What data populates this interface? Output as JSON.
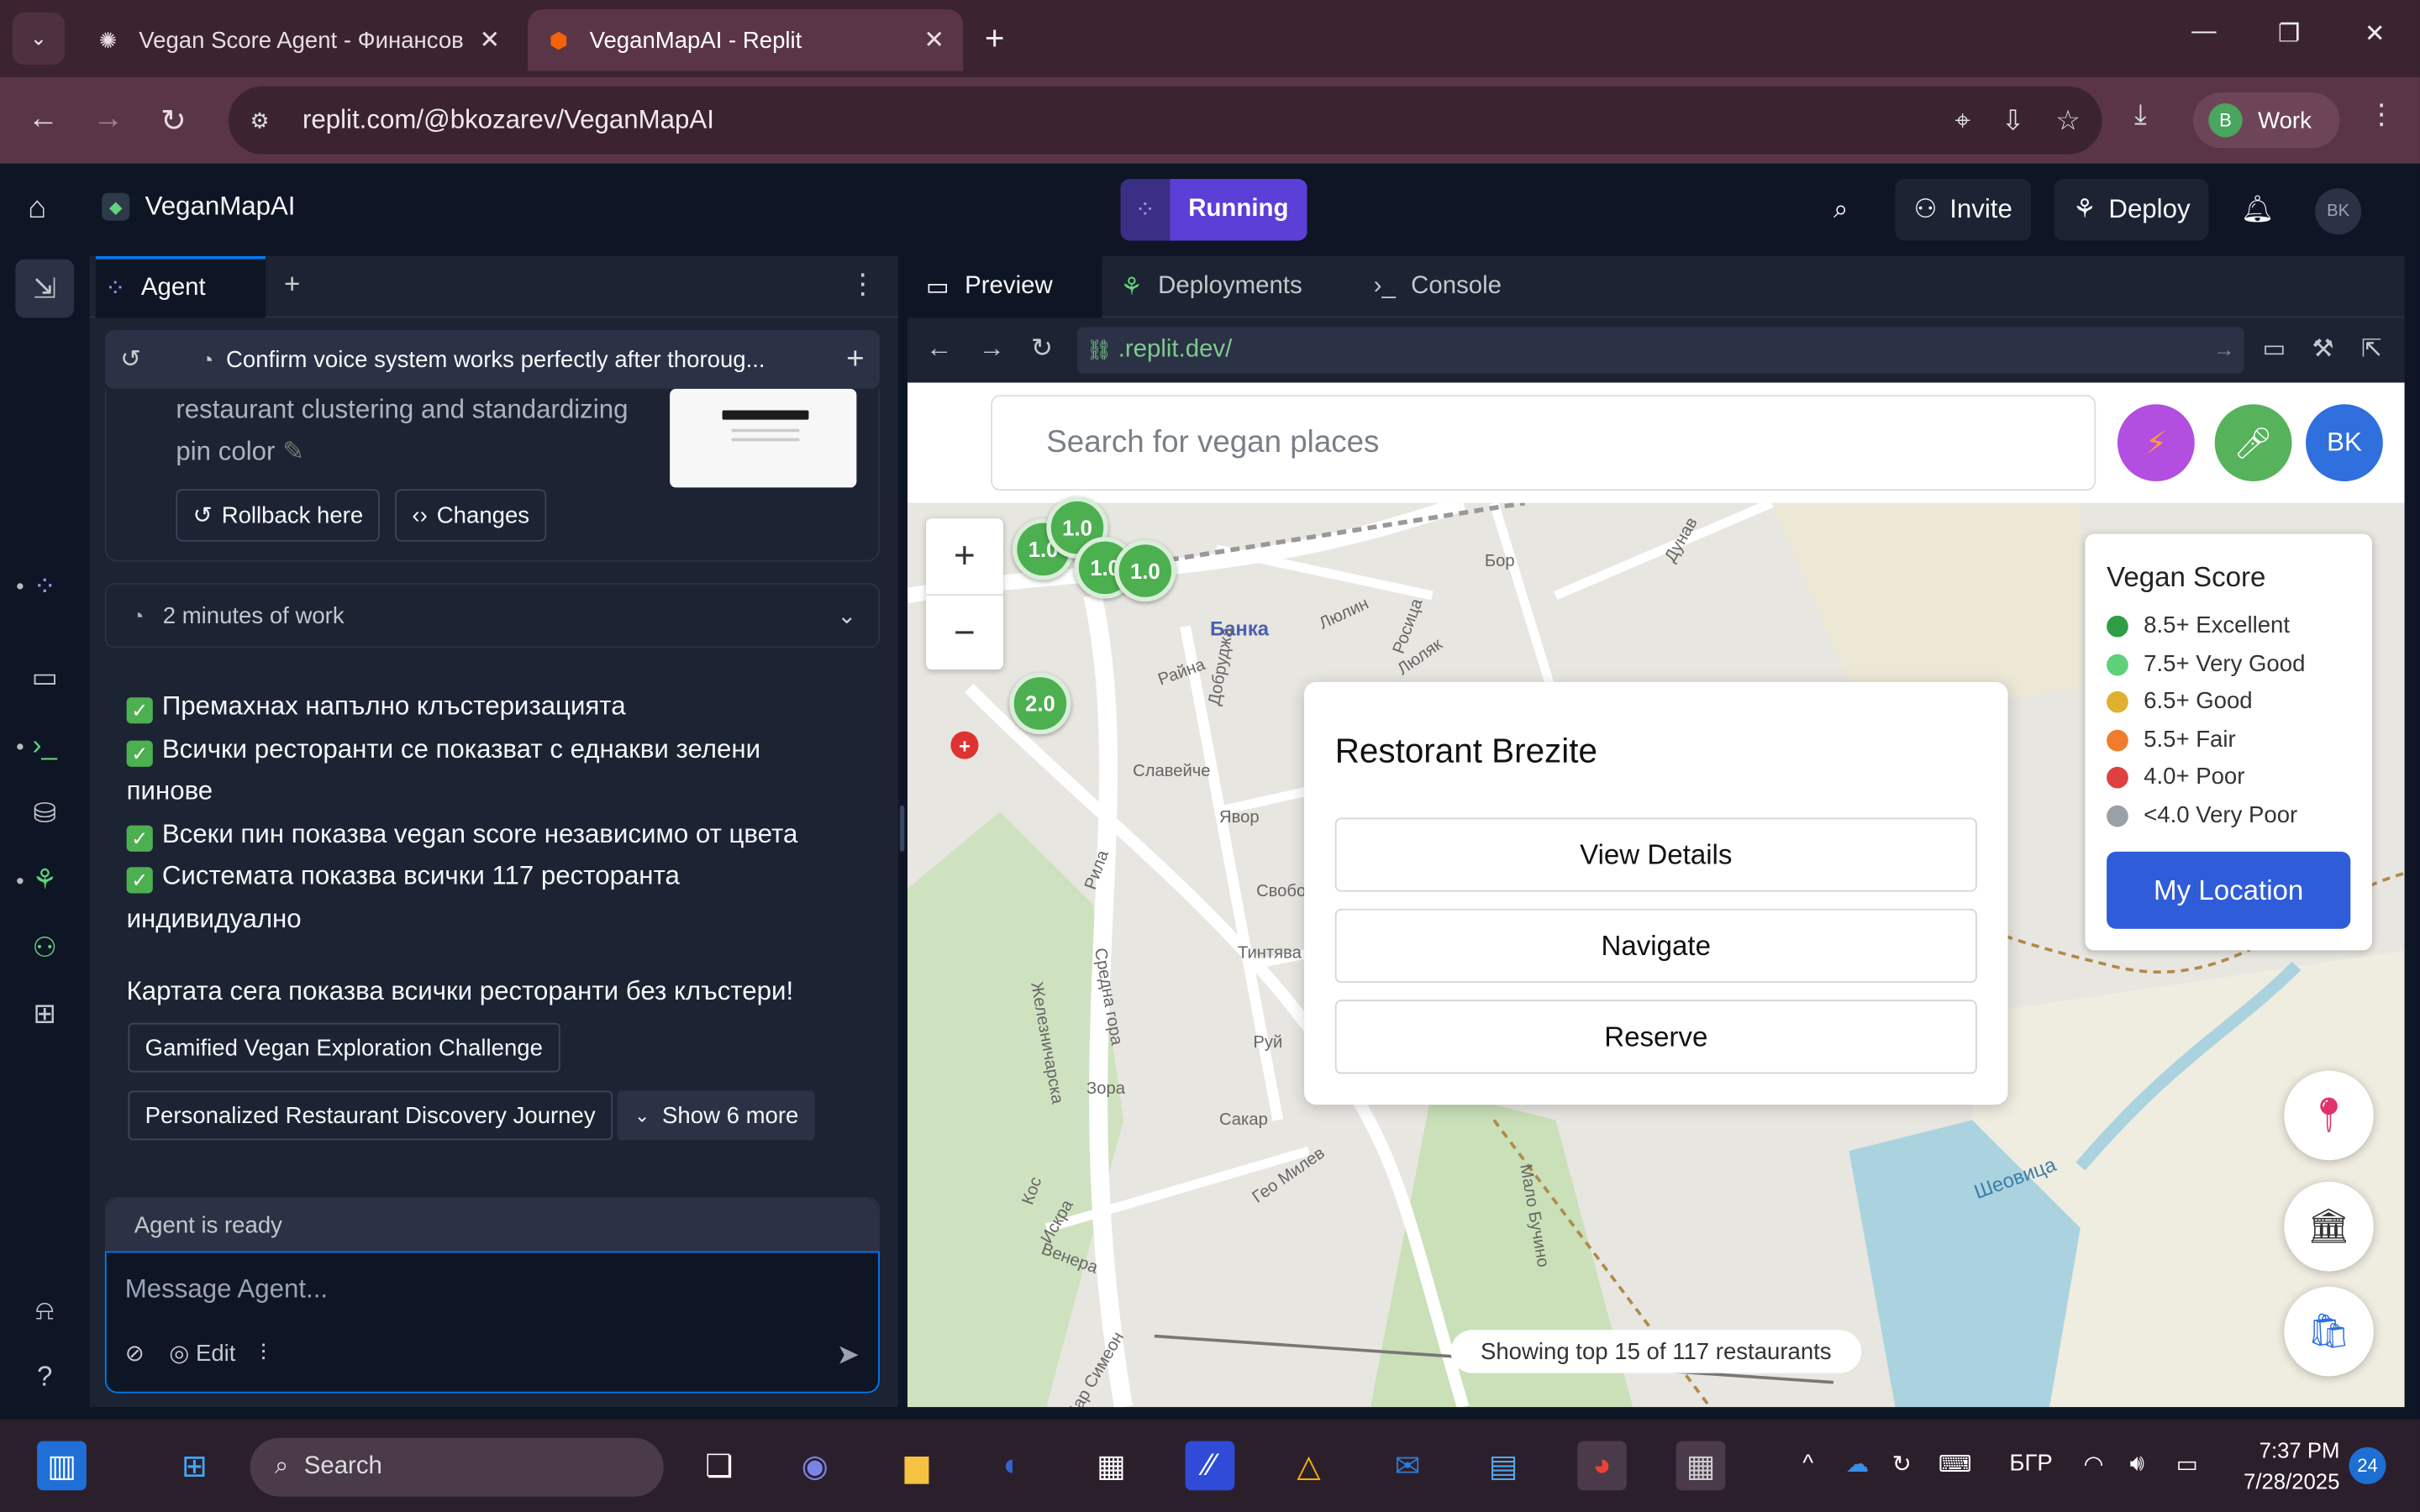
{
  "browser": {
    "tabs": [
      {
        "title": "Vegan Score Agent - Финансов",
        "active": false
      },
      {
        "title": "VeganMapAI - Replit",
        "active": true
      }
    ],
    "url": "replit.com/@bkozarev/VeganMapAI",
    "profile_initial": "B",
    "profile_label": "Work"
  },
  "replit": {
    "app_name": "VeganMapAI",
    "run_status": "Running",
    "invite_label": "Invite",
    "deploy_label": "Deploy",
    "user_initials": "BK"
  },
  "agent": {
    "tab_label": "Agent",
    "chat_title": "Confirm voice system works perfectly after thoroug...",
    "checkpoint_text": "restaurant clustering and standardizing pin color",
    "rollback_label": "Rollback here",
    "changes_label": "Changes",
    "work_time": "2 minutes of work",
    "message_items": [
      "Премахнах напълно клъстеризацията",
      "Всички ресторанти се показват с еднакви зелени пинове",
      "Всеки пин показва vegan score независимо от цвета",
      "Системата показва всички 117 ресторанта индивидуално"
    ],
    "message_summary": "Картата сега показва всички ресторанти без клъстери!",
    "suggestions": [
      "Gamified Vegan Exploration Challenge",
      "Personalized Restaurant Discovery Journey"
    ],
    "show_more_label": "Show 6 more",
    "status": "Agent is ready",
    "input_placeholder": "Message Agent...",
    "edit_label": "Edit"
  },
  "workspace": {
    "tabs": [
      "Preview",
      "Deployments",
      "Console"
    ],
    "preview_url": ".replit.dev/"
  },
  "app": {
    "search_placeholder": "Search for vegan places",
    "user_initials": "BK",
    "clusters": [
      "1.0",
      "1.0",
      "1.0",
      "1.0",
      "2.0"
    ],
    "popup": {
      "title": "Restorant Brezite",
      "buttons": [
        "View Details",
        "Navigate",
        "Reserve"
      ]
    },
    "legend": {
      "title": "Vegan Score",
      "items": [
        {
          "label": "8.5+ Excellent",
          "color": "#2e9e44"
        },
        {
          "label": "7.5+ Very Good",
          "color": "#5fd07a"
        },
        {
          "label": "6.5+ Good",
          "color": "#e0b030"
        },
        {
          "label": "5.5+ Fair",
          "color": "#ef7d2b"
        },
        {
          "label": "4.0+ Poor",
          "color": "#e04040"
        },
        {
          "label": "<4.0 Very Poor",
          "color": "#9aa0a8"
        }
      ],
      "my_location_label": "My Location"
    },
    "footer_note": "Showing top 15 of 117 restaurants",
    "map_labels": [
      "Банка",
      "Славейче",
      "Явор",
      "Рила",
      "Зора",
      "Сакар",
      "Руй",
      "Венера",
      "Цар Симеон",
      "Гео Милев",
      "Мало Бучино",
      "Шеовица",
      "Железничарска",
      "Тинтява",
      "Люлин",
      "Бор",
      "Средна гора",
      "Дунав",
      "Кос",
      "Искра",
      "Свобода",
      "Райна",
      "Росица",
      "Люляк",
      "Добруджа"
    ]
  },
  "taskbar": {
    "search_label": "Search",
    "lang": "БГР",
    "time": "7:37 PM",
    "date": "7/28/2025",
    "notifications": "24"
  }
}
